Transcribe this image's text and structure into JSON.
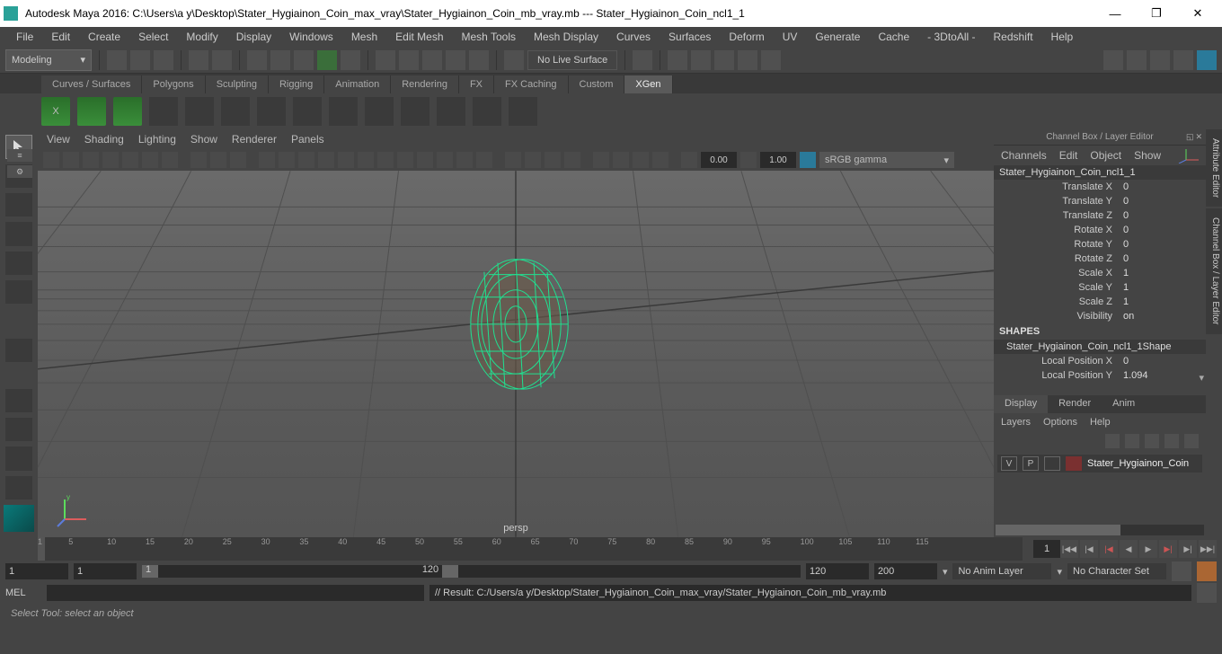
{
  "titlebar": {
    "title": "Autodesk Maya 2016: C:\\Users\\a y\\Desktop\\Stater_Hygiainon_Coin_max_vray\\Stater_Hygiainon_Coin_mb_vray.mb  ---   Stater_Hygiainon_Coin_ncl1_1"
  },
  "menubar": [
    "File",
    "Edit",
    "Create",
    "Select",
    "Modify",
    "Display",
    "Windows",
    "Mesh",
    "Edit Mesh",
    "Mesh Tools",
    "Mesh Display",
    "Curves",
    "Surfaces",
    "Deform",
    "UV",
    "Generate",
    "Cache",
    "- 3DtoAll -",
    "Redshift",
    "Help"
  ],
  "mode": "Modeling",
  "no_live": "No Live Surface",
  "shelf_tabs": [
    "Curves / Surfaces",
    "Polygons",
    "Sculpting",
    "Rigging",
    "Animation",
    "Rendering",
    "FX",
    "FX Caching",
    "Custom",
    "XGen"
  ],
  "shelf_active": 9,
  "viewport": {
    "menus": [
      "View",
      "Shading",
      "Lighting",
      "Show",
      "Renderer",
      "Panels"
    ],
    "num1": "0.00",
    "num2": "1.00",
    "srgb": "sRGB gamma",
    "label": "persp"
  },
  "channelbox": {
    "title": "Channel Box / Layer Editor",
    "menus": [
      "Channels",
      "Edit",
      "Object",
      "Show"
    ],
    "object": "Stater_Hygiainon_Coin_ncl1_1",
    "attrs": [
      {
        "label": "Translate X",
        "val": "0"
      },
      {
        "label": "Translate Y",
        "val": "0"
      },
      {
        "label": "Translate Z",
        "val": "0"
      },
      {
        "label": "Rotate X",
        "val": "0"
      },
      {
        "label": "Rotate Y",
        "val": "0"
      },
      {
        "label": "Rotate Z",
        "val": "0"
      },
      {
        "label": "Scale X",
        "val": "1"
      },
      {
        "label": "Scale Y",
        "val": "1"
      },
      {
        "label": "Scale Z",
        "val": "1"
      },
      {
        "label": "Visibility",
        "val": "on"
      }
    ],
    "shapes_label": "SHAPES",
    "shape_name": "Stater_Hygiainon_Coin_ncl1_1Shape",
    "shape_attrs": [
      {
        "label": "Local Position X",
        "val": "0"
      },
      {
        "label": "Local Position Y",
        "val": "1.094"
      }
    ],
    "disp_tabs": [
      "Display",
      "Render",
      "Anim"
    ],
    "layer_menus": [
      "Layers",
      "Options",
      "Help"
    ],
    "layer": {
      "v": "V",
      "p": "P",
      "name": "Stater_Hygiainon_Coin"
    }
  },
  "side_tabs": [
    "Attribute Editor",
    "Channel Box / Layer Editor"
  ],
  "timeline": {
    "start": "1",
    "ticks": [
      1,
      5,
      10,
      15,
      20,
      25,
      30,
      35,
      40,
      45,
      50,
      55,
      60,
      65,
      70,
      75,
      80,
      85,
      90,
      95,
      100,
      105,
      110,
      115
    ],
    "current": "1"
  },
  "range": {
    "f1": "1",
    "f2": "1",
    "f3": "1",
    "f4": "120",
    "f5": "120",
    "f6": "200",
    "anim_layer": "No Anim Layer",
    "char_set": "No Character Set"
  },
  "cmd": {
    "label": "MEL",
    "result": "// Result: C:/Users/a y/Desktop/Stater_Hygiainon_Coin_max_vray/Stater_Hygiainon_Coin_mb_vray.mb"
  },
  "help": "Select Tool: select an object"
}
